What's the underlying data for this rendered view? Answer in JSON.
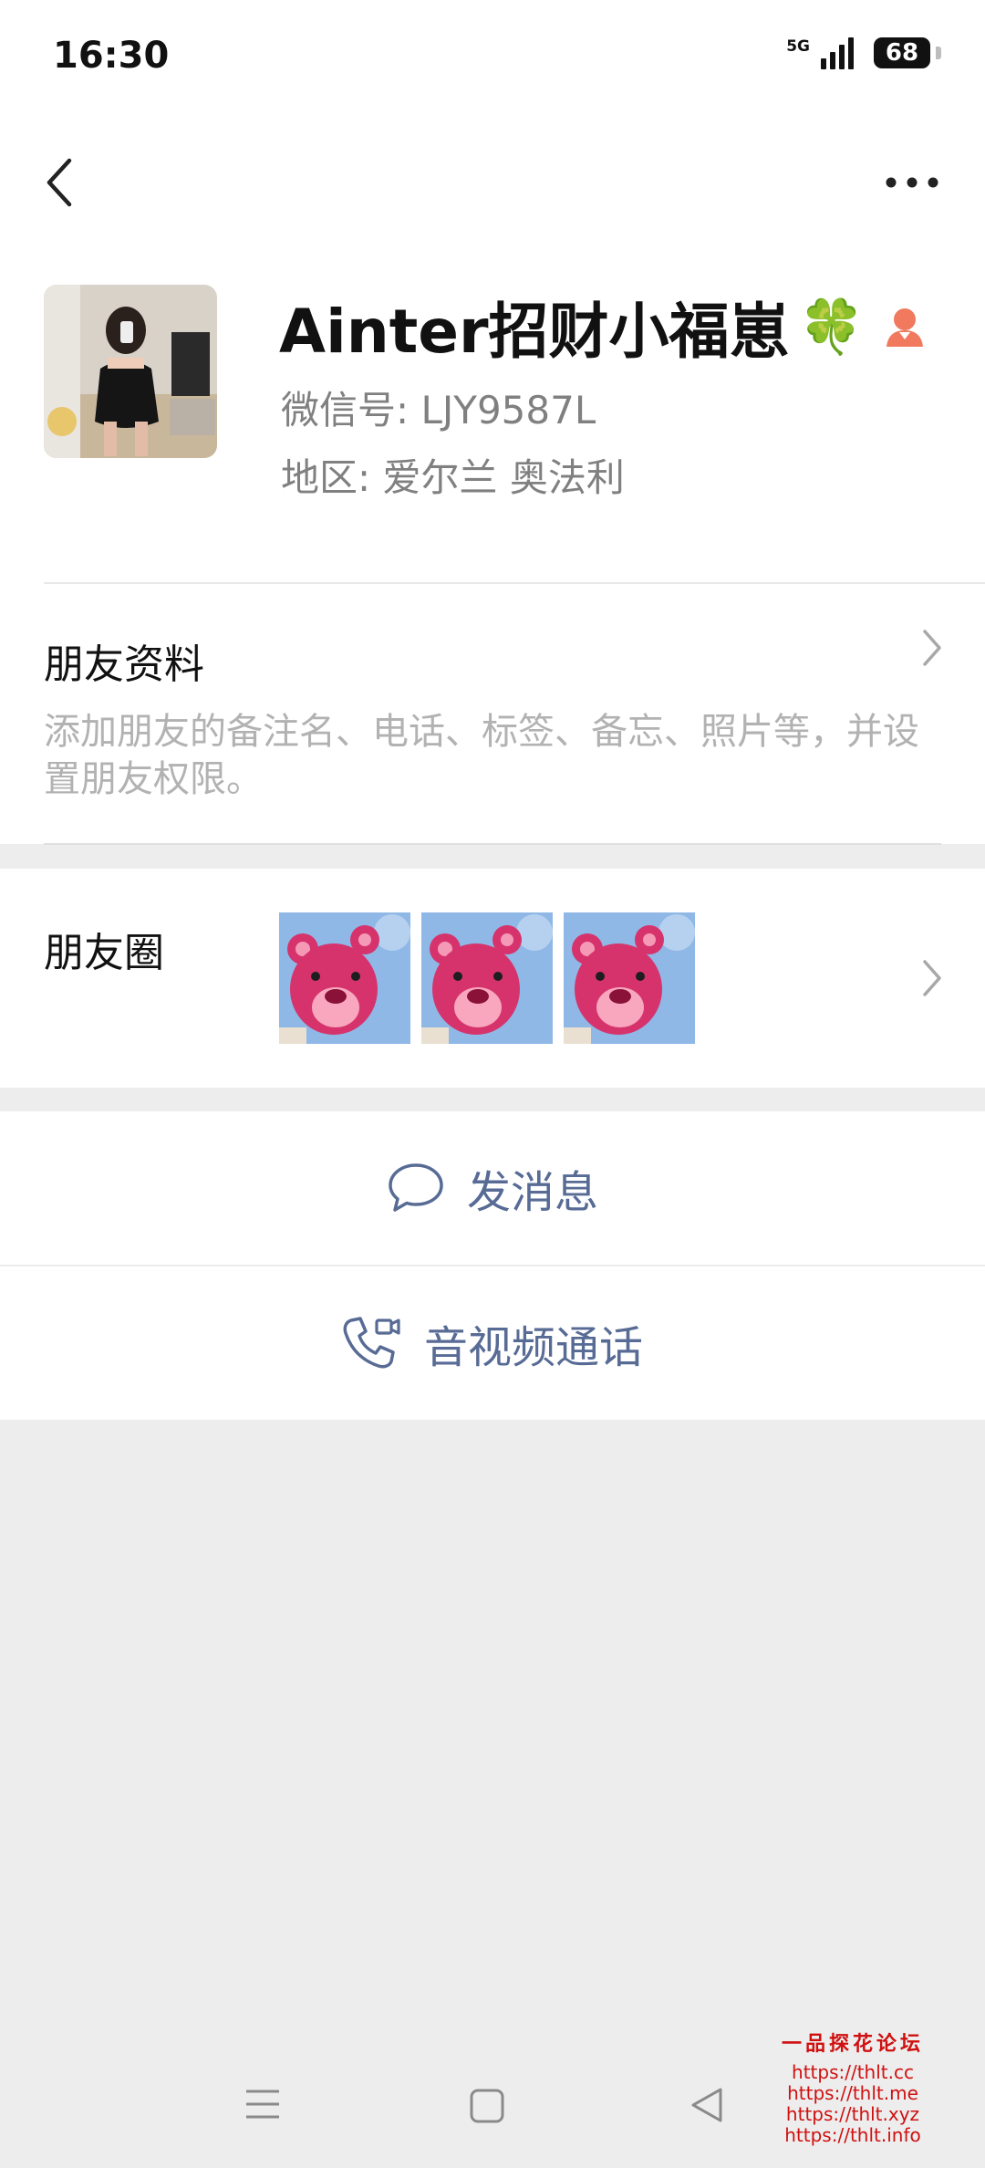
{
  "status": {
    "time": "16:30",
    "network": "5G",
    "battery": "68"
  },
  "profile": {
    "nickname": "Ainter招财小福崽",
    "wechat_id": "微信号: LJY9587L",
    "region": "地区: 爱尔兰  奥法利",
    "nickname_emoji": "🍀"
  },
  "friend_info": {
    "title": "朋友资料",
    "description": "添加朋友的备注名、电话、标签、备忘、照片等，并设置朋友权限。"
  },
  "moments": {
    "title": "朋友圈",
    "photo_count": 3
  },
  "actions": {
    "send_message": "发消息",
    "av_call": "音视频通话"
  },
  "watermark": {
    "title": "一品探花论坛",
    "links": [
      "https://thlt.cc",
      "https://thlt.me",
      "https://thlt.xyz",
      "https://thlt.info"
    ]
  },
  "colors": {
    "link_blue": "#576b95",
    "background": "#ededed",
    "watermark_red": "#d01010"
  }
}
